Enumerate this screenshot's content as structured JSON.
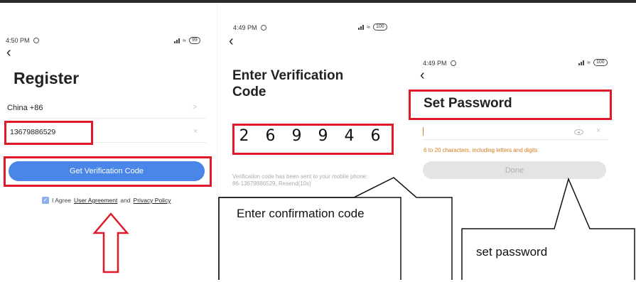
{
  "screens": [
    {
      "status": {
        "time": "4:50 PM",
        "battery": "99"
      },
      "title": "Register",
      "country": "China +86",
      "phone": "13679886529",
      "button_label": "Get Verification Code",
      "agree_prefix": "I Agree",
      "user_agreement": "User Agreement",
      "and_text": "and",
      "privacy_policy": "Privacy Policy"
    },
    {
      "status": {
        "time": "4:49 PM",
        "battery": "100"
      },
      "title_line1": "Enter Verification",
      "title_line2": "Code",
      "code_digits": [
        "2",
        "6",
        "9",
        "9",
        "4",
        "6"
      ],
      "hint_line1": "Verification code has been sent to your mobile phone:",
      "hint_line2": "86-13679886529, Resend(10s)"
    },
    {
      "status": {
        "time": "4:49 PM",
        "battery": "100"
      },
      "title": "Set Password",
      "password_hint": "6 to 20 characters, including letters and digits",
      "button_label": "Done"
    }
  ],
  "annotations": {
    "callout_confirmation": "Enter confirmation code",
    "callout_password": "set password",
    "highlight_color": "#e0192a",
    "arrow_color": "#e0192a"
  },
  "icons": [
    "alarm-icon",
    "signal-icon",
    "wifi-icon",
    "battery-icon",
    "back-icon",
    "chevron-right-icon",
    "clear-icon",
    "checkbox-icon",
    "eye-icon",
    "up-arrow-icon"
  ]
}
